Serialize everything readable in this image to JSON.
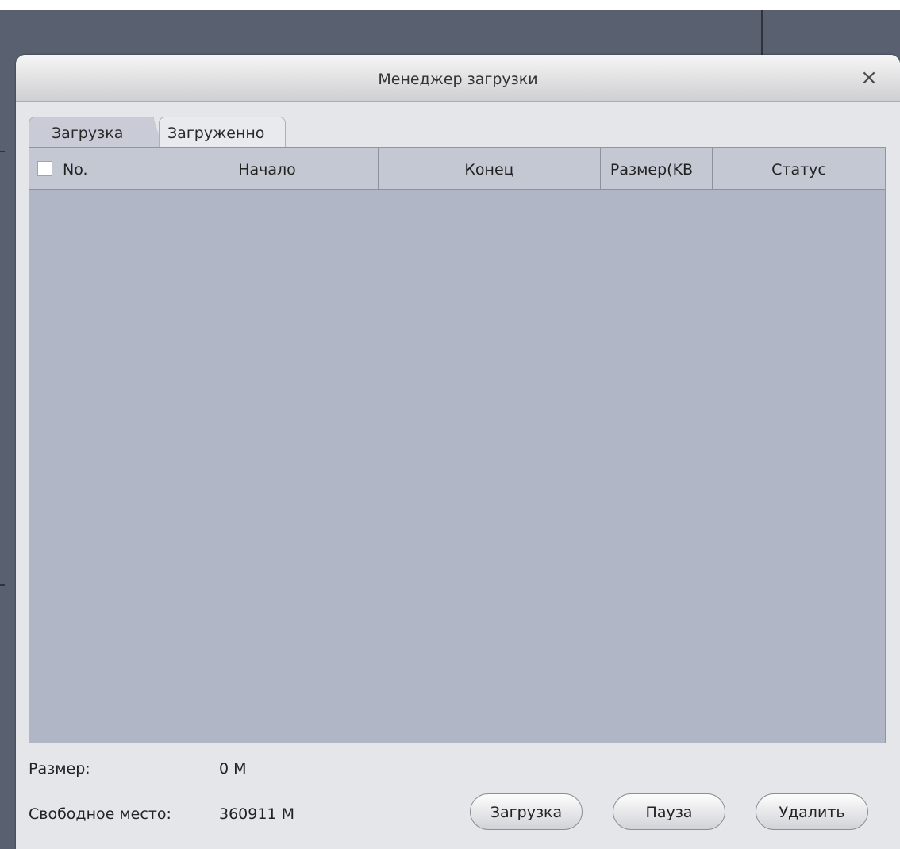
{
  "dialog": {
    "title": "Менеджер загрузки",
    "close_symbol": "×"
  },
  "tabs": [
    {
      "label": "Загрузка",
      "active": true
    },
    {
      "label": "Загруженно",
      "active": false
    }
  ],
  "table": {
    "columns": [
      "No.",
      "Начало",
      "Конец",
      "Размер(KB",
      "Статус"
    ],
    "rows": []
  },
  "info": {
    "size_label": "Размер:",
    "size_value": "0 M",
    "free_label": "Свободное место:",
    "free_value": "360911 M"
  },
  "buttons": {
    "download": "Загрузка",
    "pause": "Пауза",
    "delete": "Удалить"
  },
  "colors": {
    "background": "#59606f",
    "dialog": "#e5e6ea",
    "grid": "#b0b6c5",
    "header": "#c3c8d3"
  }
}
